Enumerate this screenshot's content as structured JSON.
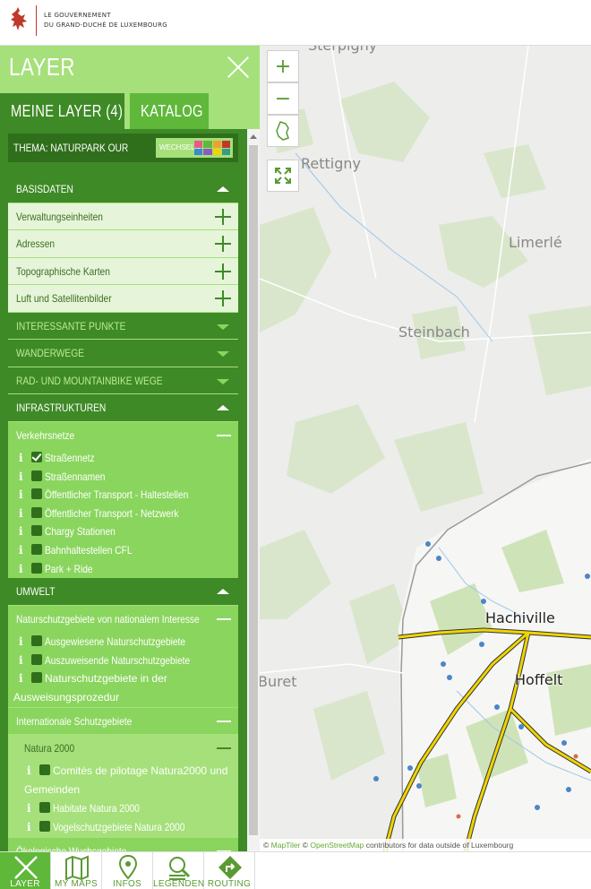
{
  "header": {
    "logo_line1": "LE GOUVERNEMENT",
    "logo_line2": "DU GRAND-DUCHÉ DE LUXEMBOURG"
  },
  "sidebar": {
    "title": "LAYER",
    "tabs": [
      {
        "label": "MEINE LAYER (4)",
        "active": true
      },
      {
        "label": "KATALOG",
        "active": false
      }
    ],
    "theme_label": "THEMA: NATURPARK OUR",
    "switch_label": "WECHSELN",
    "groups": {
      "basisdaten": {
        "label": "BASISDATEN",
        "items": [
          "Verwaltungseinheiten",
          "Adressen",
          "Topographische Karten",
          "Luft und Satellitenbilder"
        ]
      },
      "interessante_punkte": "INTERESSANTE PUNKTE",
      "wanderwege": "WANDERWEGE",
      "rad": "RAD- UND MOUNTAINBIKE WEGE",
      "infrastrukturen": {
        "label": "INFRASTRUKTUREN",
        "sub": "Verkehrsnetze",
        "layers": [
          {
            "label": "Straßennetz",
            "checked": true
          },
          {
            "label": "Straßennamen",
            "checked": false
          },
          {
            "label": "Öffentlicher Transport - Haltestellen",
            "checked": false
          },
          {
            "label": "Öffentlicher Transport - Netzwerk",
            "checked": false
          },
          {
            "label": "Chargy Stationen",
            "checked": false
          },
          {
            "label": "Bahnhaltestellen CFL",
            "checked": false
          },
          {
            "label": "Park + Ride",
            "checked": false
          }
        ]
      },
      "umwelt": {
        "label": "UMWELT",
        "sub1": "Naturschutzgebiete von nationalem Interesse",
        "sub1_layers": [
          {
            "label": "Ausgewiesene Naturschutzgebiete"
          },
          {
            "label": "Auszuweisende Naturschutzgebiete"
          },
          {
            "label": "Naturschutzgebiete in der Ausweisungsprozedur"
          }
        ],
        "sub2": "Internationale Schutzgebiete",
        "sub2a": "Natura 2000",
        "sub2a_layers": [
          {
            "label": "Comités de pilotage Natura2000 und Gemeinden"
          },
          {
            "label": "Habitate Natura 2000"
          },
          {
            "label": "Vogelschutzgebiete Natura 2000"
          }
        ],
        "sub3": "Ökologische Wuchsgebiete"
      }
    }
  },
  "map": {
    "zoom_in": "+",
    "zoom_out": "−",
    "labels": {
      "sterpigny": "Sterpigny",
      "rettigny": "Rettigny",
      "limerle": "Limerlé",
      "steinbach": "Steinbach",
      "buret": "Buret",
      "hachiville": "Hachiville",
      "hoffelt": "Hoffelt"
    },
    "attribution_prefix": "©",
    "attribution_maptiler": "MapTiler",
    "attribution_osm": "OpenStreetMap",
    "attribution_suffix": "contributors for data outside of Luxembourg"
  },
  "bottom_nav": [
    {
      "label": "LAYER",
      "icon": "close-icon",
      "active": true
    },
    {
      "label": "MY MAPS",
      "icon": "map-icon",
      "active": false
    },
    {
      "label": "INFOS",
      "icon": "pin-icon",
      "active": false
    },
    {
      "label": "LEGENDEN",
      "icon": "legend-icon",
      "active": false
    },
    {
      "label": "ROUTING",
      "icon": "routing-icon",
      "active": false
    }
  ],
  "colors": {
    "brand_green": "#5fb83a",
    "dark_green": "#3e8a26",
    "light_green": "#a5e07a",
    "road_yellow": "#f0d400"
  }
}
